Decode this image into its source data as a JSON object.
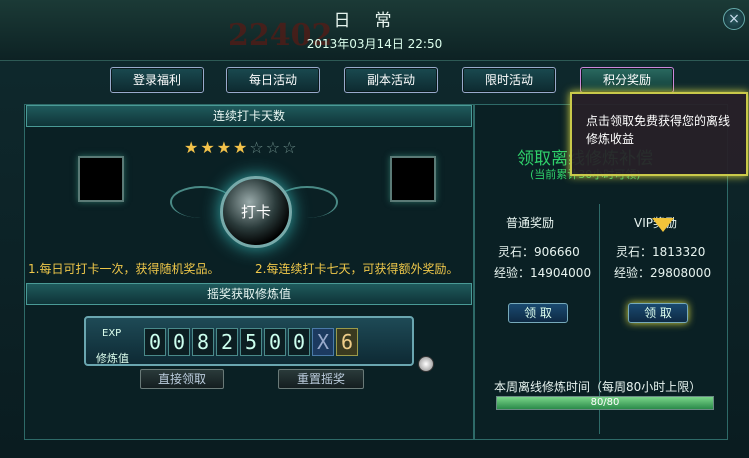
{
  "window": {
    "title": "日常",
    "datetime": "2013年03月14日   22:50",
    "bg_number": "22402"
  },
  "tabs": [
    "登录福利",
    "每日活动",
    "副本活动",
    "限时活动",
    "积分奖励"
  ],
  "checkin": {
    "header": "连续打卡天数",
    "stars_on": 4,
    "stars_total": 7,
    "button_label": "打卡",
    "tip1": "1.每日可打卡一次，获得随机奖品。",
    "tip2": "2.每连续打卡七天，可获得额外奖励。"
  },
  "lottery": {
    "header": "摇奖获取修炼值",
    "exp_label": "EXP",
    "value_label": "修炼值",
    "digits": [
      "0",
      "0",
      "8",
      "2",
      "5",
      "0",
      "0"
    ],
    "multiplier_symbol": "X",
    "multiplier": "6",
    "claim_button": "直接领取",
    "reset_button": "重置摇奖"
  },
  "offline": {
    "title": "领取离线修炼补偿",
    "subtitle": "(当前累计30小时可领)",
    "normal": {
      "title": "普通奖励",
      "stone_label": "灵石：906660",
      "exp_label": "经验：14904000",
      "button": "领 取"
    },
    "vip": {
      "title": "VIP奖励",
      "stone_label": "灵石：1813320",
      "exp_label": "经验：29808000",
      "button": "领 取"
    },
    "week_label": "本周离线修炼时间（每周80小时上限）",
    "progress_text": "80/80",
    "progress_fraction": 1.0
  },
  "tooltip": "点击领取免费获得您的离线修炼收益",
  "colors": {
    "accent": "#2fd06a",
    "gold": "#f3c24a",
    "border": "#2e6a68"
  }
}
